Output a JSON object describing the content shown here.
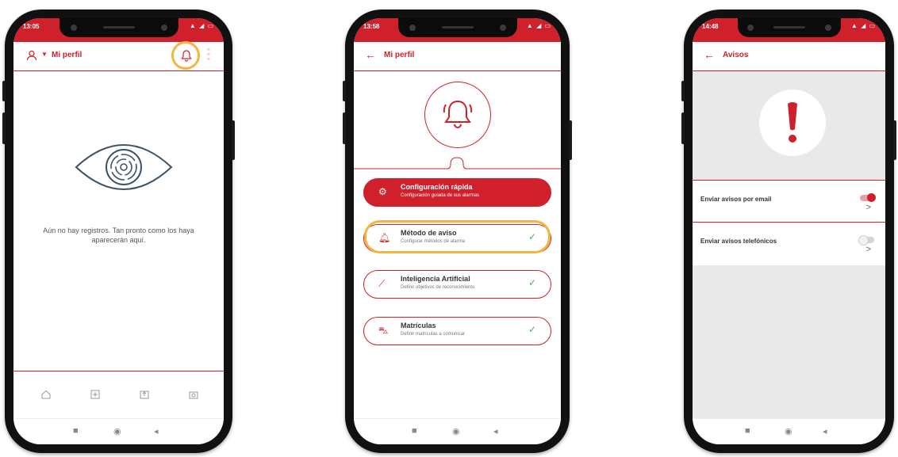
{
  "brand": {
    "accent": "#d0202b",
    "highlight": "#f2b640",
    "check": "#4caf50"
  },
  "phone1": {
    "time": "13:05",
    "title": "Mi perfil",
    "empty_message": "Aún no hay registros. Tan pronto como los haya aparecerán aquí.",
    "icons": [
      "user-icon",
      "dropdown-caret-icon",
      "bell-icon",
      "more-icon",
      "eye-maze-icon",
      "home-icon",
      "scan-icon",
      "upload-icon",
      "camera-icon"
    ]
  },
  "phone2": {
    "time": "13:58",
    "title": "Mi perfil",
    "menu": [
      {
        "title": "Configuración rápida",
        "subtitle": "Configuración guiada de sus alarmas",
        "active": true,
        "icon": "gear-icon"
      },
      {
        "title": "Método de aviso",
        "subtitle": "Configurar métodos de alarma",
        "active": false,
        "icon": "bell-icon"
      },
      {
        "title": "Inteligencia Artificial",
        "subtitle": "Definir objetivos de reconocimiento",
        "active": false,
        "icon": "magic-wand-icon"
      },
      {
        "title": "Matrículas",
        "subtitle": "Definir matrículas a comunicar",
        "active": false,
        "icon": "car-icon"
      }
    ]
  },
  "phone3": {
    "time": "14:48",
    "title": "Avisos",
    "rows": [
      {
        "label": "Enviar avisos por email",
        "enabled": true
      },
      {
        "label": "Enviar avisos telefónicos",
        "enabled": false
      }
    ]
  }
}
